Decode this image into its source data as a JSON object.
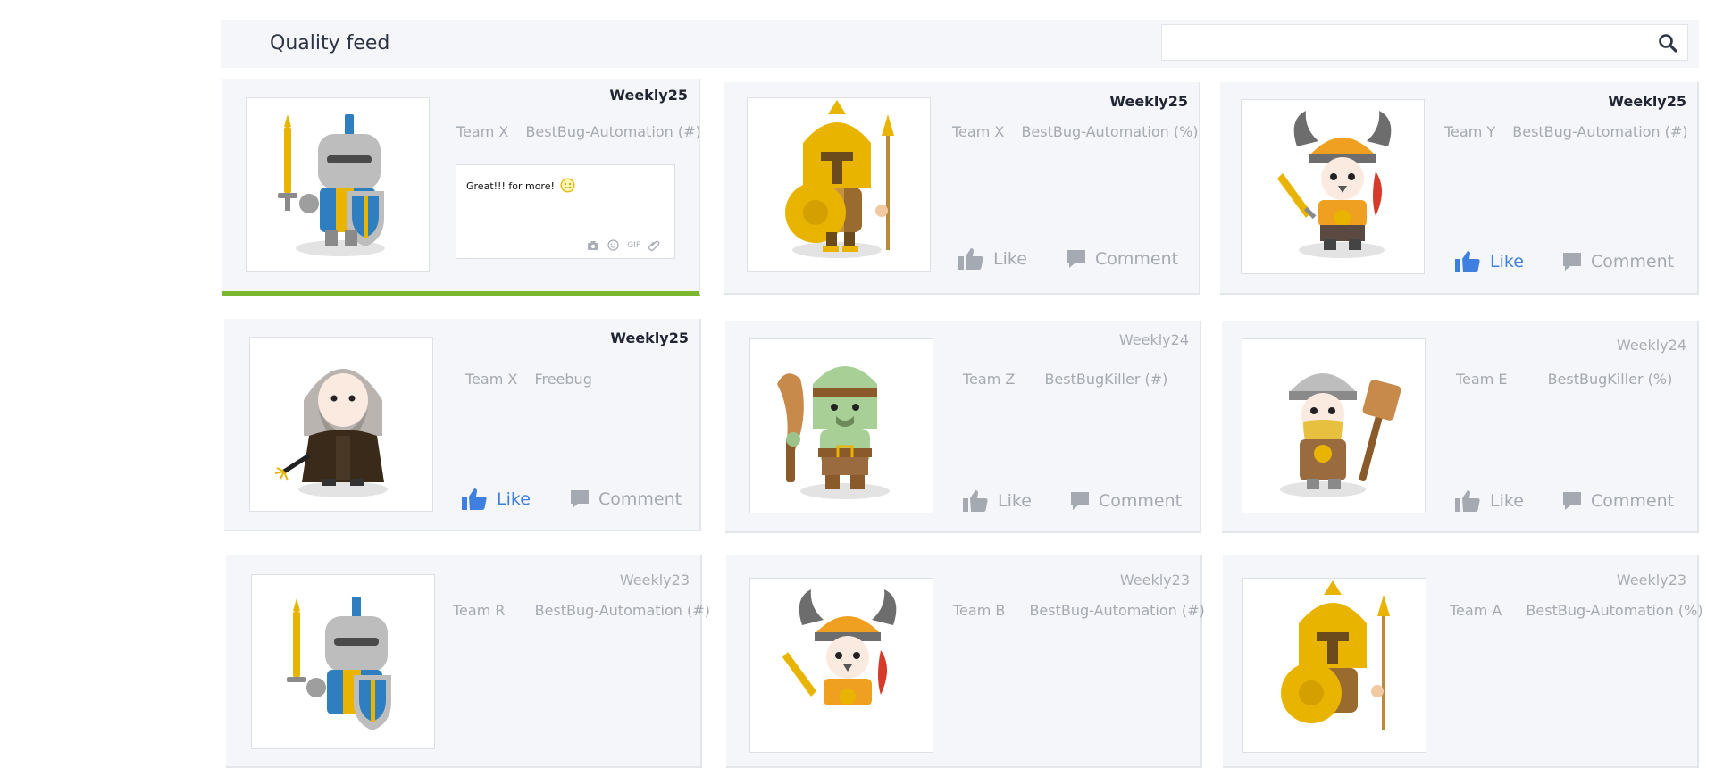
{
  "header": {
    "title": "Quality  feed",
    "search": {
      "placeholder": ""
    }
  },
  "actions": {
    "like": "Like",
    "comment": "Comment"
  },
  "colors": {
    "active_underline": "#7cb82f",
    "liked": "#3f7fe0",
    "muted": "#a5a9b1"
  },
  "cards": [
    {
      "week": "Weekly25",
      "team": "Team X",
      "badge": "BestBug-Automation (#)",
      "avatar": "knight-icon",
      "comment": "Great!!! for more!",
      "active": true
    },
    {
      "week": "Weekly25",
      "team": "Team X",
      "badge": "BestBug-Automation (%)",
      "avatar": "spartan-icon",
      "liked": false
    },
    {
      "week": "Weekly25",
      "team": "Team Y",
      "badge": "BestBug-Automation (#)",
      "avatar": "viking-icon",
      "liked": true
    },
    {
      "week": "Weekly25",
      "team": "Team X",
      "badge": "Freebug",
      "avatar": "wizard-icon",
      "liked": true
    },
    {
      "week": "Weekly24",
      "team": "Team Z",
      "badge": "BestBugKiller (#)",
      "avatar": "orc-icon",
      "liked": false
    },
    {
      "week": "Weekly24",
      "team": "Team E",
      "badge": "BestBugKiller (%)",
      "avatar": "dwarf-icon",
      "liked": false
    },
    {
      "week": "Weekly23",
      "team": "Team R",
      "badge": "BestBug-Automation (#)",
      "avatar": "knight-icon"
    },
    {
      "week": "Weekly23",
      "team": "Team B",
      "badge": "BestBug-Automation (#)",
      "avatar": "viking-icon"
    },
    {
      "week": "Weekly23",
      "team": "Team A",
      "badge": "BestBug-Automation (%)",
      "avatar": "spartan-icon"
    }
  ]
}
